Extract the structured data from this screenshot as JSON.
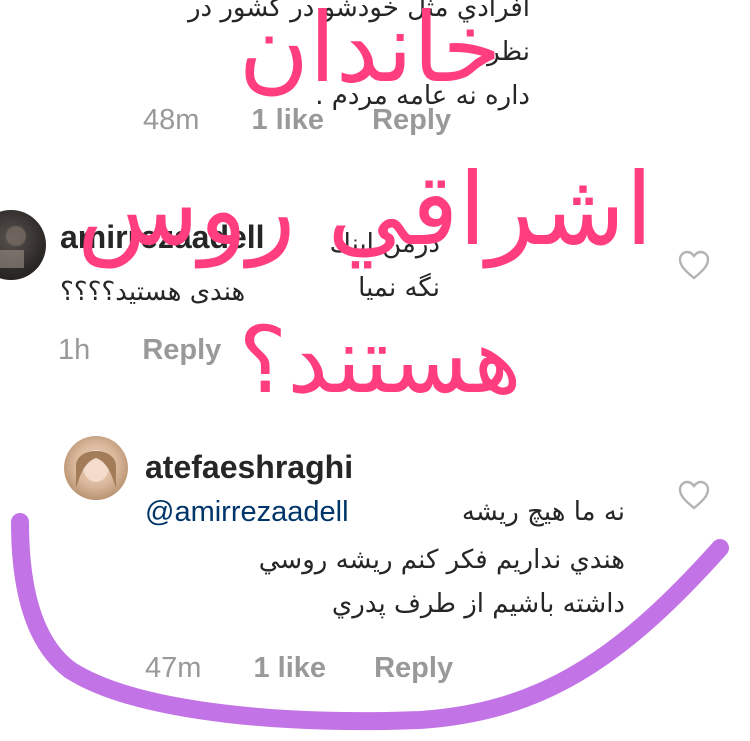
{
  "comments": [
    {
      "text_line1": "افرادي مثل خودشو در كشور در نظر",
      "text_line2": "داره نه عامه مردم .",
      "time": "48m",
      "likes": "1 like",
      "reply": "Reply"
    },
    {
      "username": "amirrezaadell",
      "text_line1": "درمن اينك نگه نميا",
      "text_line2": "هندی هستيد؟؟؟؟",
      "time": "1h",
      "reply": "Reply"
    },
    {
      "username": "atefaeshraghi",
      "mention": "@amirrezaadell",
      "text_line1_rest": "نه ما هيچ ريشه",
      "text_line2": "هندي نداريم فكر كنم ريشه روسي",
      "text_line3": "داشته باشيم از طرف پدري",
      "time": "47m",
      "likes": "1 like",
      "reply": "Reply"
    }
  ],
  "overlay": {
    "line1": "خاندان",
    "line2": "اشراقي روس",
    "line3": "هستند؟",
    "color": "#ff3d7f"
  },
  "annotation_color": "#c274e6",
  "icons": {
    "heart": "heart-outline-icon",
    "avatar": "avatar"
  }
}
